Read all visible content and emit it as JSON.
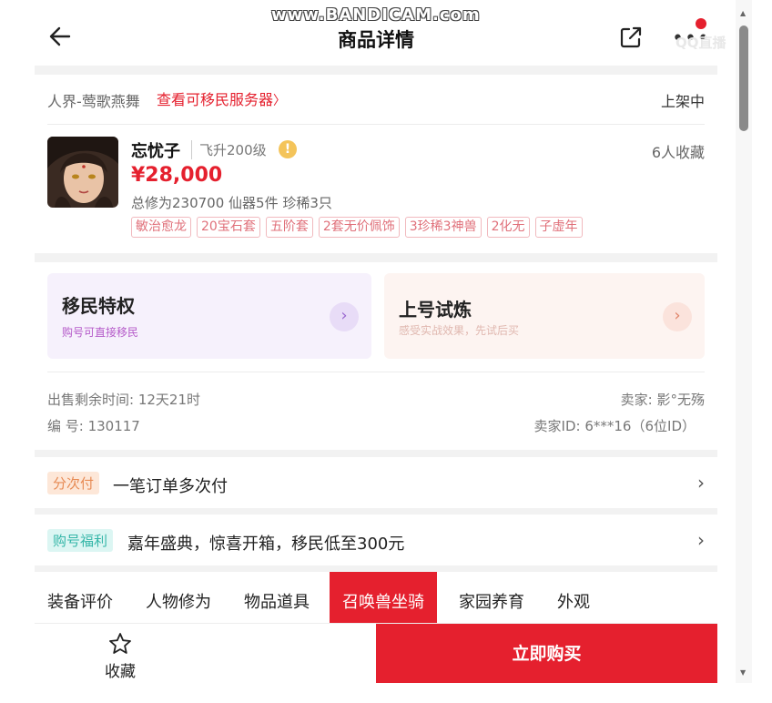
{
  "watermark": "www.BANDICAM.com",
  "corner_watermark": "QQ直播",
  "header": {
    "title": "商品详情",
    "more": "•••"
  },
  "account": {
    "server": "人界-莺歌燕舞",
    "server_link": "查看可移民服务器",
    "link_chevron": "〉",
    "status": "上架中",
    "name": "忘忧子",
    "level": "飞升200级",
    "warn": "!",
    "favorites": "6人收藏",
    "price": "¥28,000",
    "stats": "总修为230700  仙器5件  珍稀3只",
    "tags": [
      "敏治愈龙",
      "20宝石套",
      "五阶套",
      "2套无价佩饰",
      "3珍稀3神兽",
      "2化无",
      "子虚年"
    ]
  },
  "promo": {
    "left": {
      "title": "移民特权",
      "subtitle": "购号可直接移民",
      "arrow": "›"
    },
    "right": {
      "title": "上号试炼",
      "subtitle": "感受实战效果，先试后买",
      "arrow": "›"
    }
  },
  "meta": {
    "time_left": "出售剩余时间: 12天21时",
    "seller": "卖家: 影°无殇",
    "serial": "编 号: 130117",
    "seller_id": "卖家ID: 6***16（6位ID）"
  },
  "installment": {
    "badge": "分次付",
    "text": "一笔订单多次付",
    "chevron": "›"
  },
  "welfare": {
    "badge": "购号福利",
    "text": "嘉年盛典，惊喜开箱，移民低至300元",
    "chevron": "›"
  },
  "tabs": [
    {
      "label": "装备评价"
    },
    {
      "label": "人物修为"
    },
    {
      "label": "物品道具"
    },
    {
      "label": "召唤兽坐骑"
    },
    {
      "label": "家园养育"
    },
    {
      "label": "外观"
    }
  ],
  "active_tab": "召唤兽坐骑",
  "bottom": {
    "favorite": "收藏",
    "buy": "立即购买"
  },
  "scrollbar": {
    "up": "▲",
    "down": "▼"
  },
  "colors": {
    "accent": "#e5202e",
    "background": "#f2f2f2"
  }
}
